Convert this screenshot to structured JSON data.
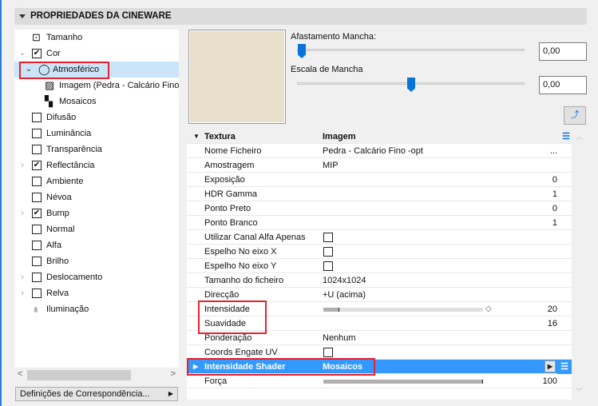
{
  "panel_title": "PROPRIEDADES DA CINEWARE",
  "tree": [
    {
      "label": "Tamanho",
      "icon": "size-icon",
      "level": 1
    },
    {
      "label": "Cor",
      "checked": true,
      "expanded": true,
      "level": 1
    },
    {
      "label": "Atmosférico",
      "icon": "sphere-icon",
      "expanded": true,
      "selected": true,
      "level": 2
    },
    {
      "label": "Imagem (Pedra - Calcário Fino -opt)",
      "icon": "image-icon",
      "level": 3
    },
    {
      "label": "Mosaicos",
      "icon": "checker-icon",
      "level": 3
    },
    {
      "label": "Difusão",
      "checked": false,
      "level": 1
    },
    {
      "label": "Luminância",
      "checked": false,
      "level": 1
    },
    {
      "label": "Transparência",
      "checked": false,
      "level": 1
    },
    {
      "label": "Reflectância",
      "checked": true,
      "collapsed": true,
      "level": 1
    },
    {
      "label": "Ambiente",
      "checked": false,
      "level": 1
    },
    {
      "label": "Névoa",
      "checked": false,
      "level": 1
    },
    {
      "label": "Bump",
      "checked": true,
      "collapsed": true,
      "level": 1
    },
    {
      "label": "Normal",
      "checked": false,
      "level": 1
    },
    {
      "label": "Alfa",
      "checked": false,
      "level": 1
    },
    {
      "label": "Brilho",
      "checked": false,
      "level": 1
    },
    {
      "label": "Deslocamento",
      "checked": false,
      "collapsed": true,
      "level": 1
    },
    {
      "label": "Relva",
      "checked": false,
      "collapsed": true,
      "level": 1
    },
    {
      "label": "Iluminação",
      "icon": "light-icon",
      "level": 1
    }
  ],
  "mapping_button": "Definições de Correspondência...",
  "sliders": [
    {
      "label": "Afastamento Mancha:",
      "value": "0,00",
      "position": 0
    },
    {
      "label": "Escala de Mancha",
      "value": "0,00",
      "position": 0.5
    }
  ],
  "table": {
    "header": {
      "key": "Textura",
      "value": "Imagem"
    },
    "rows": [
      {
        "key": "Nome Ficheiro",
        "value": "Pedra - Calcário Fino -opt",
        "num": "..."
      },
      {
        "key": "Amostragem",
        "value": "MIP"
      },
      {
        "key": "Exposição",
        "num": "0"
      },
      {
        "key": "HDR Gamma",
        "num": "1"
      },
      {
        "key": "Ponto Preto",
        "num": "0"
      },
      {
        "key": "Ponto Branco",
        "num": "1"
      },
      {
        "key": "Utilizar Canal Alfa Apenas",
        "checkbox": false
      },
      {
        "key": "Espelho No eixo X",
        "checkbox": false
      },
      {
        "key": "Espelho No eixo Y",
        "checkbox": false
      },
      {
        "key": "Tamanho do ficheiro",
        "value": "1024x1024"
      },
      {
        "key": "Direcção",
        "value": "+U (acima)"
      },
      {
        "key": "Intensidade",
        "bar": 0.1,
        "num": "20"
      },
      {
        "key": "Suavidade",
        "num": "16"
      },
      {
        "key": "Ponderação",
        "value": "Nenhum"
      },
      {
        "key": "Coords Engate UV",
        "checkbox": false
      },
      {
        "key": "Intensidade Shader",
        "value": "Mosaicos",
        "highlight": true
      },
      {
        "key": "Força",
        "bar": 1.0,
        "num": "100"
      }
    ]
  },
  "colors": {
    "accent": "#3399ff",
    "highlight_box": "#e8212e",
    "selection": "#cce4f7"
  }
}
